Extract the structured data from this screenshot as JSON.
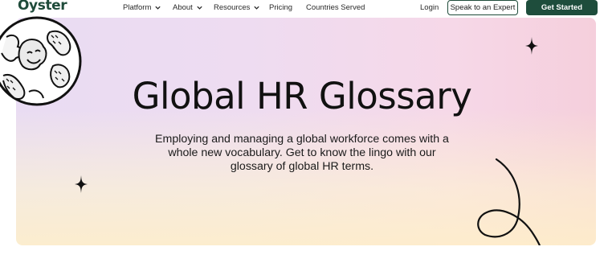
{
  "brand": {
    "logo_text": "Oyster",
    "color": "#1f4b3a"
  },
  "nav": {
    "items": [
      {
        "label": "Platform",
        "has_dropdown": true
      },
      {
        "label": "About",
        "has_dropdown": true
      },
      {
        "label": "Resources",
        "has_dropdown": true
      },
      {
        "label": "Pricing",
        "has_dropdown": false
      },
      {
        "label": "Countries Served",
        "has_dropdown": false
      }
    ],
    "login_label": "Login",
    "expert_button_label": "Speak to an Expert",
    "cta_button_label": "Get Started",
    "cta_color": "#1e4d3c"
  },
  "hero": {
    "title": "Global HR Glossary",
    "subtitle": "Employing and managing a global workforce comes with a whole new vocabulary. Get to know the lingo with our glossary of global HR terms."
  },
  "icons": [
    "chevron-down-icon",
    "globe-illustration",
    "sparkle-icon",
    "loop-swirl-icon"
  ]
}
